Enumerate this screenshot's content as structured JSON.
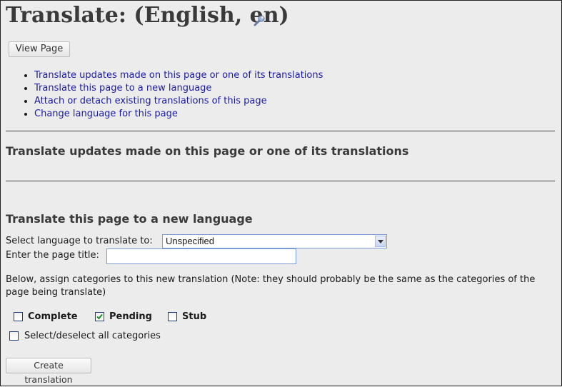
{
  "page": {
    "title": "Translate:  (English, en)",
    "view_page_label": "View Page"
  },
  "actions": [
    {
      "label": "Translate updates made on this page or one of its translations"
    },
    {
      "label": "Translate this page to a new language"
    },
    {
      "label": "Attach or detach existing translations of this page"
    },
    {
      "label": "Change language for this page"
    }
  ],
  "sections": {
    "updates": {
      "heading": "Translate updates made on this page or one of its translations"
    },
    "new_language": {
      "heading": "Translate this page to a new language",
      "language_label": "Select language to translate to:",
      "language_value": "Unspecified",
      "title_label": "Enter the page title:",
      "title_value": "",
      "note": "Below, assign categories to this new translation (Note: they should probably be the same as the categories of the page being translate)",
      "categories": [
        {
          "label": "Complete",
          "checked": false
        },
        {
          "label": "Pending",
          "checked": true
        },
        {
          "label": "Stub",
          "checked": false
        }
      ],
      "select_all_label": "Select/deselect all categories",
      "select_all_checked": false,
      "create_label": "Create translation"
    }
  },
  "colors": {
    "link": "#1a1aa6",
    "heading": "#3a3a3a",
    "background": "#ececec"
  },
  "icons": {
    "title_edit": "wrench-icon"
  }
}
